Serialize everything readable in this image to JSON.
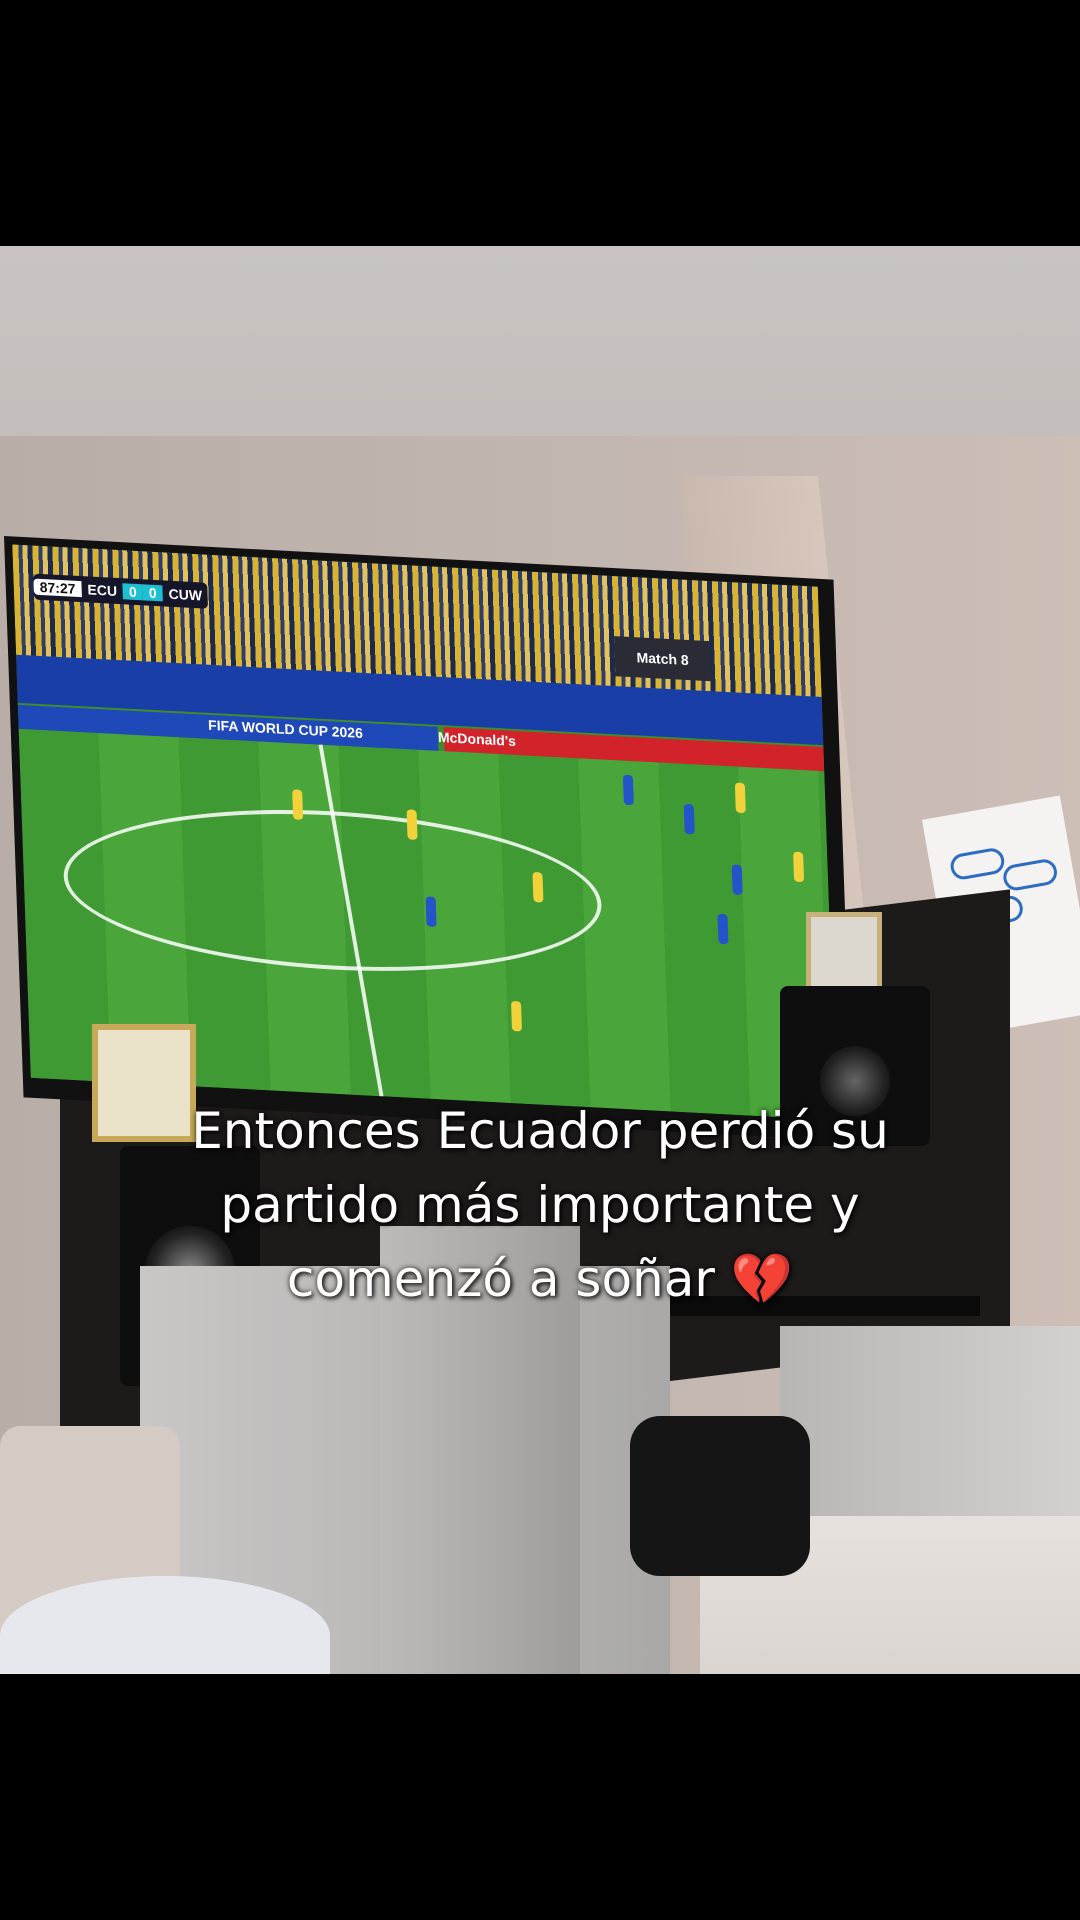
{
  "tv": {
    "clock": "87:27",
    "home_team": "ECU",
    "home_score": "0",
    "away_score": "0",
    "away_team": "CUW",
    "match_label": "Match 8",
    "ad_left": "FIFA WORLD CUP 2026",
    "ad_right": "McDonald's"
  },
  "caption": {
    "line1": "Entonces Ecuador perdió su",
    "line2": "partido más importante y",
    "line3": "comenzó a soñar 💔"
  },
  "colors": {
    "caption_text": "#ffffff",
    "letterbox": "#000000",
    "scoreboard_accent": "#1dbfd0"
  }
}
